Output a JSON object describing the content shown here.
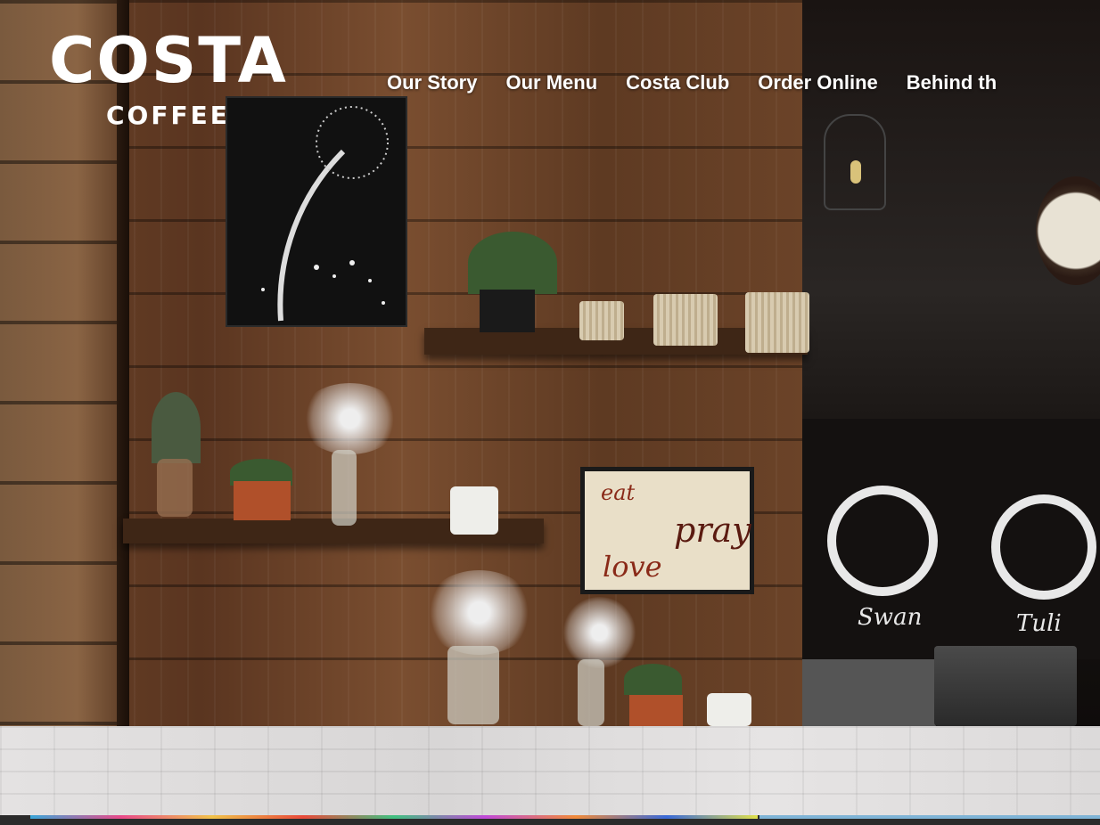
{
  "brand": {
    "name": "COSTA",
    "tagline": "COFFEE"
  },
  "nav": {
    "items": [
      {
        "label": "Our Story"
      },
      {
        "label": "Our Menu"
      },
      {
        "label": "Costa Club"
      },
      {
        "label": "Order Online"
      },
      {
        "label": "Behind th"
      }
    ]
  },
  "hero": {
    "sign": {
      "eat": "eat",
      "pray": "pray",
      "love": "love"
    },
    "board": {
      "swan": "Swan",
      "tulip": "Tuli"
    }
  }
}
